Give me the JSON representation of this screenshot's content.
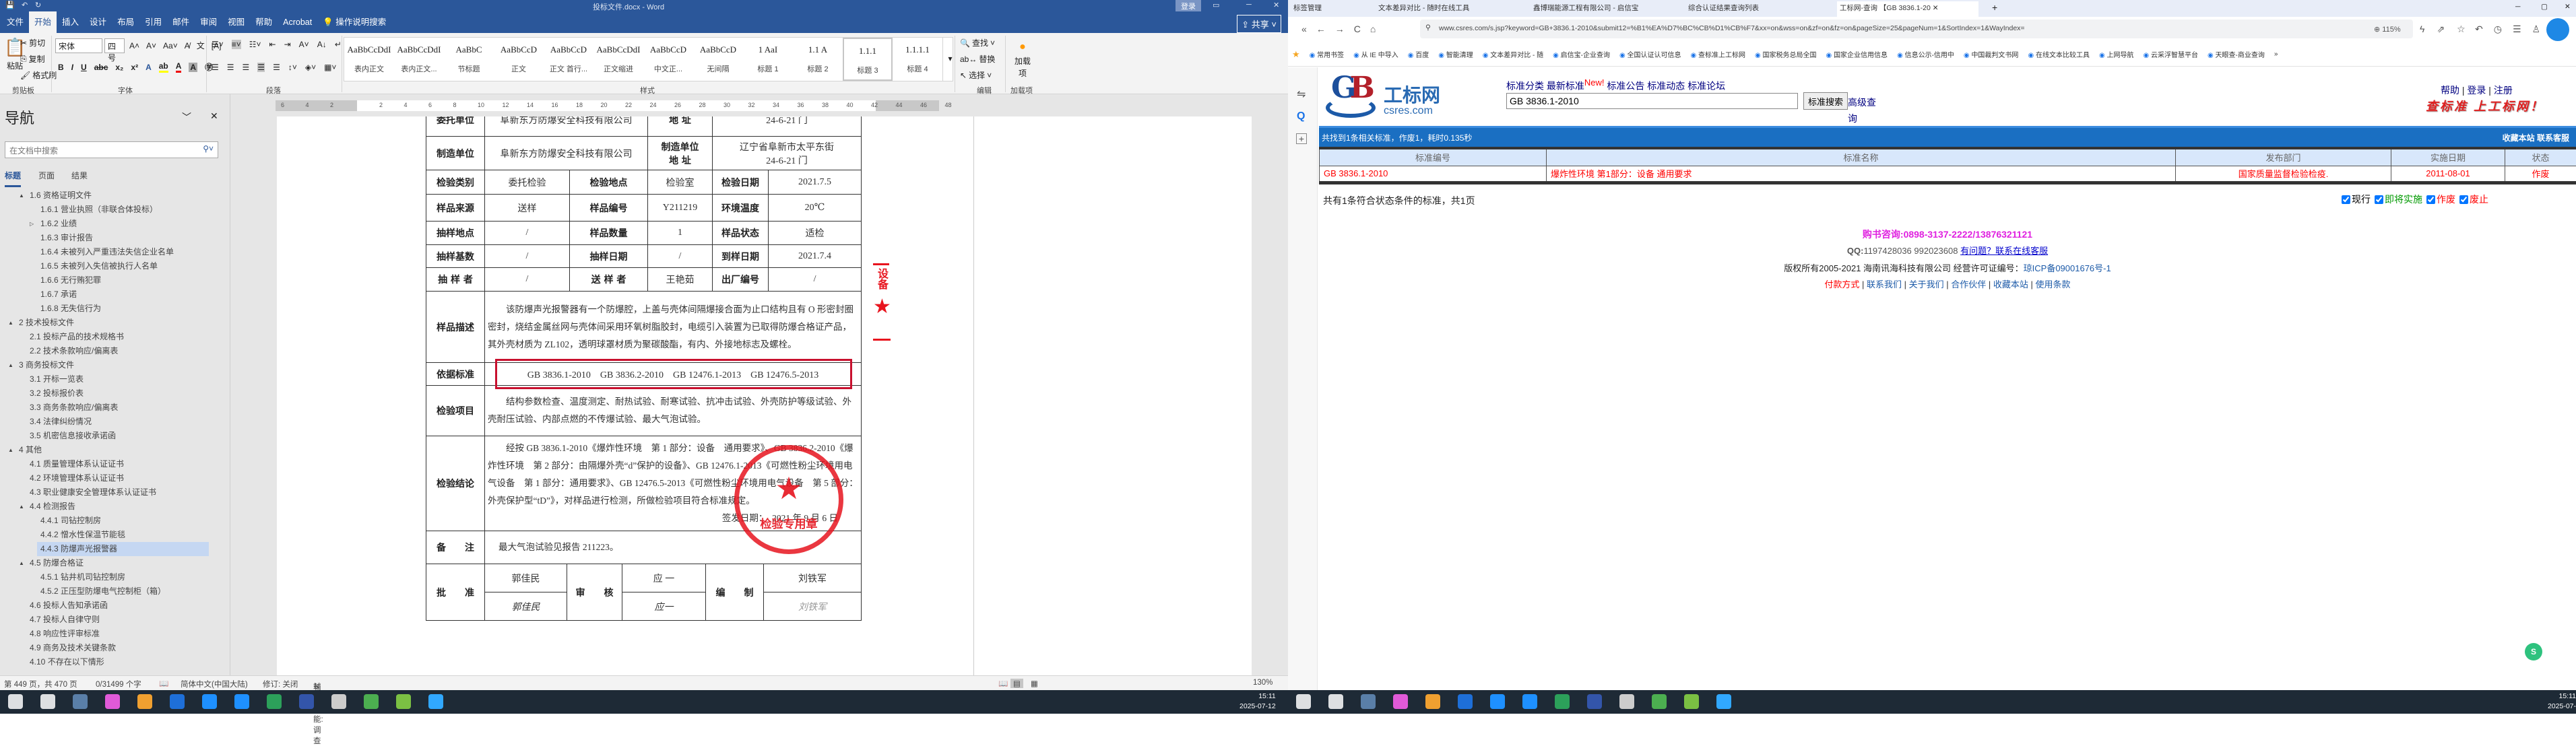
{
  "word": {
    "title": "投标文件.docx - Word",
    "login": "登录",
    "share": "共享",
    "tabs": [
      "文件",
      "开始",
      "插入",
      "设计",
      "布局",
      "引用",
      "邮件",
      "审阅",
      "视图",
      "帮助",
      "Acrobat"
    ],
    "tell_me": "操作说明搜索",
    "clipboard": {
      "paste": "粘贴",
      "cut": "剪切",
      "copy": "复制",
      "format_painter": "格式刷",
      "label": "剪贴板"
    },
    "font": {
      "name": "宋体",
      "size": "四号",
      "label": "字体"
    },
    "paragraph_label": "段落",
    "styles": [
      {
        "preview": "AaBbCcDdI",
        "label": "表内正文"
      },
      {
        "preview": "AaBbCcDdI",
        "label": "表内正文..."
      },
      {
        "preview": "AaBbC",
        "label": "节标题"
      },
      {
        "preview": "AaBbCcD",
        "label": "正文"
      },
      {
        "preview": "AaBbCcD",
        "label": "正文 首行..."
      },
      {
        "preview": "AaBbCcDdI",
        "label": "正文缩进"
      },
      {
        "preview": "AaBbCcD",
        "label": "中文正..."
      },
      {
        "preview": "AaBbCcD",
        "label": "无间隔"
      },
      {
        "preview": "1  AaI",
        "label": "标题 1"
      },
      {
        "preview": "1.1  A",
        "label": "标题 2"
      },
      {
        "preview": "1.1.1",
        "label": "标题 3"
      },
      {
        "preview": "1.1.1.1",
        "label": "标题 4"
      }
    ],
    "styles_label": "样式",
    "editing": {
      "find": "查找",
      "replace": "替换",
      "select": "选择",
      "label": "编辑"
    },
    "addins": {
      "button": "加载项",
      "label": "加载项"
    },
    "nav": {
      "title": "导航",
      "search_placeholder": "在文档中搜索",
      "tabs": [
        "标题",
        "页面",
        "结果"
      ],
      "items": [
        {
          "t": "1.6 资格证明文件",
          "l": 2,
          "tw": "▲"
        },
        {
          "t": "1.6.1 营业执照（非联合体投标）",
          "l": 3
        },
        {
          "t": "1.6.2 业绩",
          "l": 3,
          "tw": "▷"
        },
        {
          "t": "1.6.3 审计报告",
          "l": 3
        },
        {
          "t": "1.6.4 未被列入严重违法失信企业名单",
          "l": 3
        },
        {
          "t": "1.6.5 未被列入失信被执行人名单",
          "l": 3
        },
        {
          "t": "1.6.6 无行贿犯罪",
          "l": 3
        },
        {
          "t": "1.6.7 承诺",
          "l": 3
        },
        {
          "t": "1.6.8 无失信行为",
          "l": 3
        },
        {
          "t": "2 技术投标文件",
          "l": 1,
          "tw": "▲"
        },
        {
          "t": "2.1 投标产品的技术规格书",
          "l": 2
        },
        {
          "t": "2.2 技术条款响应/偏离表",
          "l": 2
        },
        {
          "t": "3 商务投标文件",
          "l": 1,
          "tw": "▲"
        },
        {
          "t": "3.1 开标一览表",
          "l": 2
        },
        {
          "t": "3.2 投标报价表",
          "l": 2
        },
        {
          "t": "3.3 商务条款响应/偏离表",
          "l": 2
        },
        {
          "t": "3.4 法律纠纷情况",
          "l": 2
        },
        {
          "t": "3.5 机密信息接收承诺函",
          "l": 2
        },
        {
          "t": "4 其他",
          "l": 1,
          "tw": "▲"
        },
        {
          "t": "4.1 质量管理体系认证证书",
          "l": 2
        },
        {
          "t": "4.2 环境管理体系认证证书",
          "l": 2
        },
        {
          "t": "4.3 职业健康安全管理体系认证证书",
          "l": 2
        },
        {
          "t": "4.4 检测报告",
          "l": 2,
          "tw": "▲"
        },
        {
          "t": "4.4.1 司钻控制房",
          "l": 3
        },
        {
          "t": "4.4.2 憎水性保温节能毯",
          "l": 3
        },
        {
          "t": "4.4.3 防爆声光报警器",
          "l": 3,
          "sel": true
        },
        {
          "t": "4.5 防爆合格证",
          "l": 2,
          "tw": "▲"
        },
        {
          "t": "4.5.1 钻井机司钻控制房",
          "l": 3
        },
        {
          "t": "4.5.2 正压型防爆电气控制柜（箱）",
          "l": 3
        },
        {
          "t": "4.6 投标人告知承诺函",
          "l": 2
        },
        {
          "t": "4.7 投标人自律守则",
          "l": 2
        },
        {
          "t": "4.8 响应性评审标准",
          "l": 2
        },
        {
          "t": "4.9 商务及技术关键条款",
          "l": 2
        },
        {
          "t": "4.10 不存在以下情形",
          "l": 2
        }
      ]
    },
    "ruler_ticks": [
      "6",
      "4",
      "2",
      "",
      "2",
      "4",
      "6",
      "8",
      "10",
      "12",
      "14",
      "16",
      "18",
      "20",
      "22",
      "24",
      "26",
      "28",
      "30",
      "32",
      "34",
      "36",
      "38",
      "40",
      "42",
      "44",
      "46",
      "48"
    ],
    "status": {
      "page": "第 449 页，共 470 页",
      "words": "0/31499 个字",
      "lang": "简体中文(中国大陆)",
      "track": "修订: 关闭",
      "access": "辅助功能: 调查",
      "zoom": "130%"
    }
  },
  "report": {
    "r0": {
      "l1": "委托单位",
      "v1": "阜新东方防爆安全科技有限公司",
      "l2": "地  址",
      "v2": "24-6-21 门"
    },
    "r1": {
      "l1": "制造单位",
      "v1": "阜新东方防爆安全科技有限公司",
      "l2a": "制造单位",
      "l2b": "地  址",
      "v2a": "辽宁省阜新市太平东街",
      "v2b": "24-6-21 门"
    },
    "grid": [
      [
        "检验类别",
        "委托检验",
        "检验地点",
        "检验室",
        "检验日期",
        "2021.7.5"
      ],
      [
        "样品来源",
        "送样",
        "样品编号",
        "Y211219",
        "环境温度",
        "20℃"
      ],
      [
        "抽样地点",
        "/",
        "样品数量",
        "1",
        "样品状态",
        "适检"
      ],
      [
        "抽样基数",
        "/",
        "抽样日期",
        "/",
        "到样日期",
        "2021.7.4"
      ],
      [
        "抽 样 者",
        "/",
        "送 样 者",
        "王艳茹",
        "出厂编号",
        "/"
      ]
    ],
    "desc_label": "样品描述",
    "desc": "　　该防爆声光报警器有一个防爆腔，上盖与壳体间隔爆接合面为止口结构且有 O 形密封圈密封，烧结金属丝网与壳体间采用环氧树脂胶封，电缆引入装置为已取得防爆合格证产品，其外壳材质为 ZL102，透明球罩材质为聚碳酸酯，有内、外接地标志及螺栓。",
    "std_label": "依据标准",
    "standards": "GB 3836.1-2010　GB 3836.2-2010　GB 12476.1-2013　GB 12476.5-2013",
    "items_label": "检验项目",
    "items": "　　结构参数检查、温度测定、耐热试验、耐寒试验、抗冲击试验、外壳防护等级试验、外壳耐压试验、内部点燃的不传爆试验、最大气泡试验。",
    "concl_label": "检验结论",
    "concl": "　　经按 GB 3836.1-2010《爆炸性环境　第 1 部分：设备　通用要求》、GB 3836.2-2010《爆炸性环境　第 2 部分：由隔爆外壳“d”保护的设备》、GB 12476.1-2013《可燃性粉尘环境用电气设备　第 1 部分：通用要求》、GB 12476.5-2013《可燃性粉尘环境用电气设备　第 5 部分：外壳保护型“tD”》，对样品进行检测，所做检验项目符合标准规定。",
    "issue_date": "签发日期：　2021 年 9 月 6 日",
    "note_label": "备　　注",
    "note": "最大气泡试验见报告 211223。",
    "approve_label": "批　　准",
    "approver": "郭佳民",
    "approver_sig": "郭佳民",
    "review_label": "审　　核",
    "reviewer": "应 一",
    "reviewer_sig": "应一",
    "compile_label": "编　　制",
    "compiler": "刘铁军",
    "compiler_sig": "刘铁军",
    "stamp_text": "检验专用章",
    "side_seal": "设备"
  },
  "browser": {
    "tabs": [
      "标签管理",
      "文本差异对比 - 随时在线工具",
      "鑫博瑞能源工程有限公司 - 启信宝",
      "综合认证结果查询列表",
      "工标网-查询 【GB 3836.1-20"
    ],
    "url": "www.csres.com/s.jsp?keyword=GB+3836.1-2010&submit12=%B1%EA%D7%BC%CB%D1%CB%F7&xx=on&wss=on&zf=on&fz=on&pageSize=25&pageNum=1&SortIndex=1&WayIndex=",
    "zoom": "115%",
    "bookmarks": [
      "常用书签",
      "从 IE 中导入",
      "百度",
      "智能清理",
      "文本差异对比 - 随",
      "启信宝-企业查询",
      "全国认证认可信息",
      "查标准上工标网",
      "国家税务总局全国",
      "国家企业信用信息",
      "信息公示-信用中",
      "中国裁判文书网",
      "在线文本比较工具",
      "上网导航",
      "云采浮智慧平台",
      "天眼查-商业查询"
    ]
  },
  "site": {
    "logo_cn": "工标网",
    "logo_en": "csres.com",
    "nav": [
      "标准分类",
      "最新标准",
      "标准公告",
      "标准动态",
      "标准论坛"
    ],
    "new_badge": "New!",
    "search_value": "GB 3836.1-2010",
    "search_btn": "标准搜索",
    "advanced": "高级查询",
    "top_links": [
      "帮助",
      "登录",
      "注册"
    ],
    "slogan": "查标准 上工标网！",
    "result_summary": "共找到1条相关标准，作废1，耗时0.135秒",
    "bar_links": "收藏本站  联系客服",
    "columns": [
      "标准编号",
      "标准名称",
      "发布部门",
      "实施日期",
      "状态"
    ],
    "rows": [
      [
        "GB 3836.1-2010",
        "爆炸性环境 第1部分：设备 通用要求",
        "国家质量监督检验检疫.",
        "2011-08-01",
        "作废"
      ]
    ],
    "count_text": "共有1条符合状态条件的标准，共1页",
    "filters": [
      {
        "label": "现行",
        "color": "#000000"
      },
      {
        "label": "即将实施",
        "color": "#009900"
      },
      {
        "label": "作废",
        "color": "#ff0000"
      },
      {
        "label": "废止",
        "color": "#ff0000"
      }
    ],
    "footer": {
      "phone": "购书咨询:0898-3137-2222/13876321121",
      "qq_label": "QQ:",
      "qq": "1197428036 992023608",
      "qq_link": "有问题？联系在线客服",
      "copyright": "版权所有2005-2021 海南讯海科技有限公司 经营许可证编号：",
      "icp": "琼ICP备09001676号-1",
      "links": [
        "付款方式",
        "联系我们",
        "关于我们",
        "合作伙伴",
        "收藏本站",
        "使用条款"
      ]
    }
  },
  "taskbar": {
    "time": "15:11",
    "date": "2025-07-12"
  }
}
